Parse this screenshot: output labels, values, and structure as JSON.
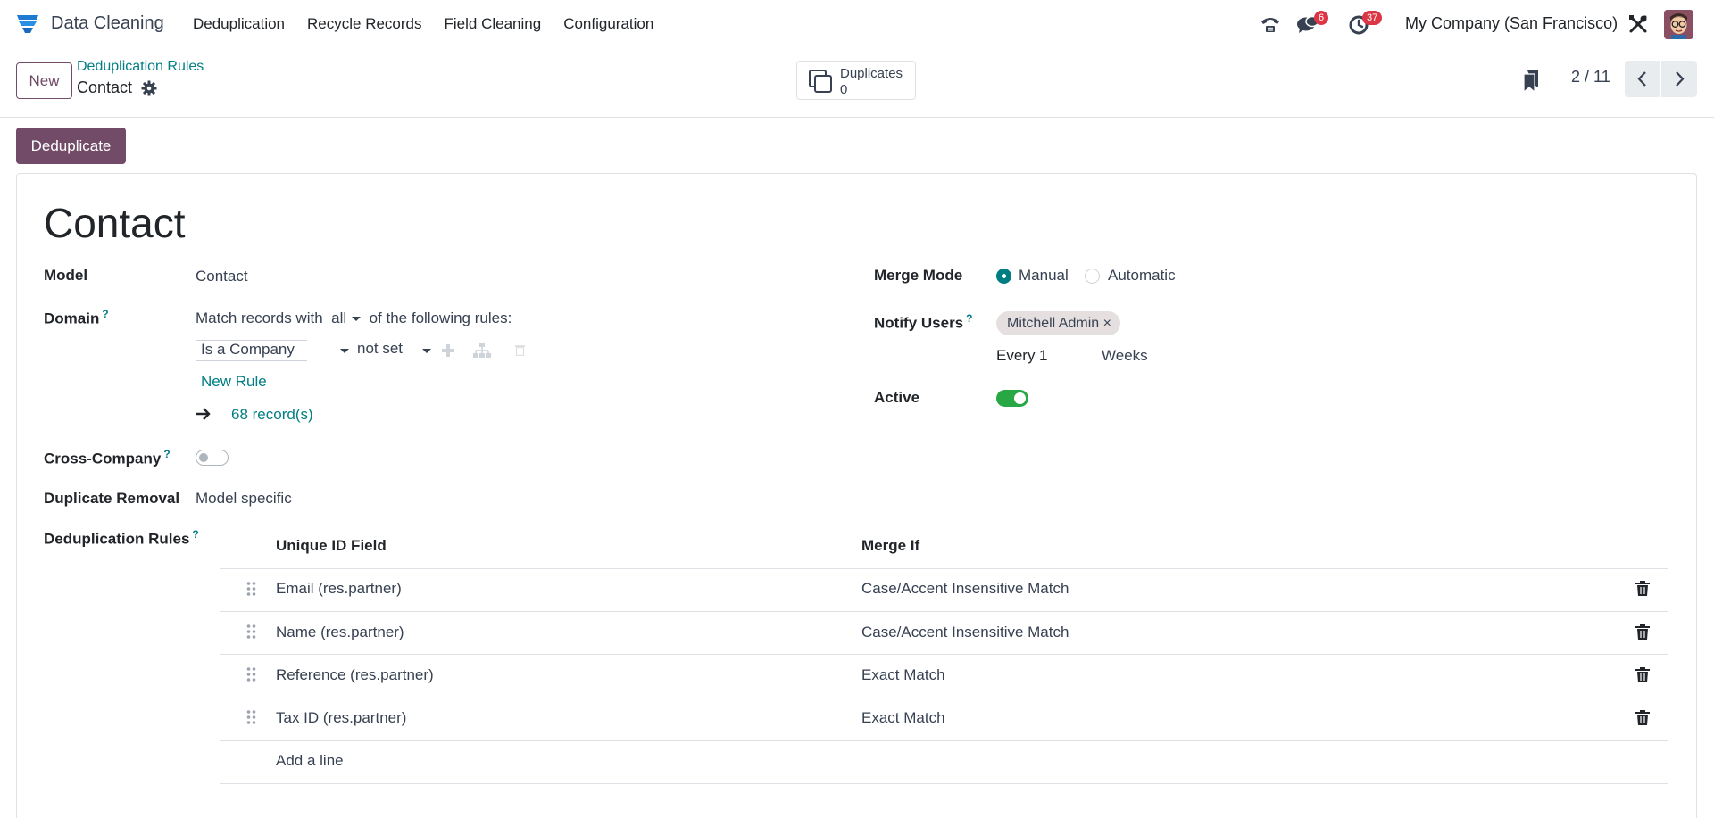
{
  "app": {
    "title": "Data Cleaning",
    "logo_icon": "app-logo-icon"
  },
  "nav_menu": [
    "Deduplication",
    "Recycle Records",
    "Field Cleaning",
    "Configuration"
  ],
  "systray": {
    "messages_count": "6",
    "activities_count": "37",
    "company": "My Company (San Francisco)"
  },
  "control_panel": {
    "new_label": "New",
    "breadcrumb_parent": "Deduplication Rules",
    "breadcrumb_current": "Contact",
    "smart_button": {
      "label": "Duplicates",
      "value": "0"
    },
    "pager": "2 / 11"
  },
  "status": {
    "deduplicate_label": "Deduplicate"
  },
  "form": {
    "title": "Contact",
    "model_label": "Model",
    "model_value": "Contact",
    "domain_label": "Domain",
    "domain_help": "?",
    "domain_intro_pre": "Match records with",
    "domain_intro_select": "all",
    "domain_intro_post": "of the following rules:",
    "domain_rule_field": "Is a Company ",
    "domain_rule_operator": "not set",
    "new_rule": "New Rule",
    "records_link": "68 record(s)",
    "cross_company_label": "Cross-Company",
    "cross_company_help": "?",
    "cross_company_enabled": false,
    "duplicate_removal_label": "Duplicate Removal",
    "duplicate_removal_value": "Model specific",
    "merge_mode_label": "Merge Mode",
    "merge_mode_options": [
      "Manual",
      "Automatic"
    ],
    "merge_mode_selected": "Manual",
    "notify_users_label": "Notify Users",
    "notify_users_help": "?",
    "notify_users_tag": "Mitchell Admin",
    "notify_every_label": "Every",
    "notify_every_value": "1",
    "notify_every_unit": "Weeks",
    "active_label": "Active",
    "active_enabled": true,
    "dedup_rules_label": "Deduplication Rules",
    "dedup_rules_help": "?"
  },
  "rules_table": {
    "columns": [
      "Unique ID Field",
      "Merge If"
    ],
    "rows": [
      {
        "field": "Email (res.partner)",
        "merge_if": "Case/Accent Insensitive Match"
      },
      {
        "field": "Name (res.partner)",
        "merge_if": "Case/Accent Insensitive Match"
      },
      {
        "field": "Reference (res.partner)",
        "merge_if": "Exact Match"
      },
      {
        "field": "Tax ID (res.partner)",
        "merge_if": "Exact Match"
      }
    ],
    "add_line": "Add a line"
  },
  "colors": {
    "primary": "#714b67",
    "link": "#017e84",
    "toggle_on": "#28a745",
    "badge": "#dc3545"
  }
}
